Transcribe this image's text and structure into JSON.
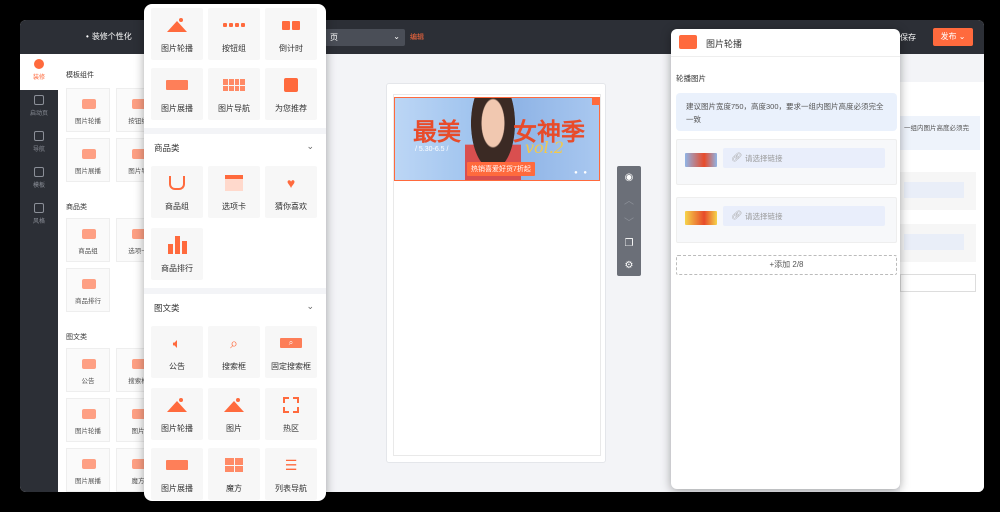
{
  "header": {
    "title": "装修个性化",
    "page_select": "页",
    "edit_label": "编辑",
    "save_label": "保存",
    "publish_label": "发布"
  },
  "left_nav": {
    "items": [
      {
        "label": "装修",
        "active": true
      },
      {
        "label": "启动页"
      },
      {
        "label": "导航"
      },
      {
        "label": "模板"
      },
      {
        "label": "风格"
      }
    ]
  },
  "back_panel": {
    "section_template": "模板组件",
    "section_goods": "商品类",
    "section_content": "图文类",
    "cells": [
      "图片轮播",
      "按钮组",
      "图片展播",
      "图片导",
      "商品组",
      "选项卡",
      "商品排行",
      "公告",
      "搜索框",
      "图片轮播",
      "图片",
      "图片展播",
      "魔方"
    ],
    "right_hint": "一组内图片高度必须完"
  },
  "component_panel": {
    "template_items": [
      {
        "label": "图片轮播",
        "icon": "mountain-icon"
      },
      {
        "label": "按钮组",
        "icon": "dots-icon"
      },
      {
        "label": "倒计时",
        "icon": "countdown-icon"
      },
      {
        "label": "图片展播",
        "icon": "banner-icon"
      },
      {
        "label": "图片导航",
        "icon": "grid-icon"
      },
      {
        "label": "为您推荐",
        "icon": "gift-icon"
      }
    ],
    "goods_title": "商品类",
    "goods_items": [
      {
        "label": "商品组",
        "icon": "cart-icon"
      },
      {
        "label": "选项卡",
        "icon": "tabs-icon"
      },
      {
        "label": "猜你喜欢",
        "icon": "heart-icon"
      },
      {
        "label": "商品排行",
        "icon": "rank-icon"
      }
    ],
    "content_title": "图文类",
    "content_items": [
      {
        "label": "公告",
        "icon": "speaker-icon"
      },
      {
        "label": "搜索框",
        "icon": "search-icon"
      },
      {
        "label": "固定搜索框",
        "icon": "search-bar-icon"
      },
      {
        "label": "图片轮播",
        "icon": "mountain-icon"
      },
      {
        "label": "图片",
        "icon": "image-icon"
      },
      {
        "label": "热区",
        "icon": "hotzone-icon"
      },
      {
        "label": "图片展播",
        "icon": "banner-icon"
      },
      {
        "label": "魔方",
        "icon": "cube-icon"
      },
      {
        "label": "列表导航",
        "icon": "list-icon"
      }
    ]
  },
  "canvas": {
    "banner": {
      "text_left": "最美",
      "text_right": "女神季",
      "date": "/ 5.30-6.5 /",
      "vol": "vol.2",
      "tag": "热销喜爱好货7折起"
    }
  },
  "toolbar": {
    "tools": [
      "eye-icon",
      "up-icon",
      "down-icon",
      "copy-icon",
      "settings-icon"
    ]
  },
  "settings_panel": {
    "title": "图片轮播",
    "subtitle": "轮播图片",
    "hint": "建议图片宽度750，高度300，要求一组内图片高度必须完全一致",
    "rows": [
      {
        "placeholder": "请选择链接"
      },
      {
        "placeholder": "请选择链接"
      }
    ],
    "add_label": "+添加 2/8"
  },
  "colors": {
    "accent": "#ff6a3d",
    "dark": "#2c2f36",
    "hint_bg": "#eaf1fc"
  }
}
